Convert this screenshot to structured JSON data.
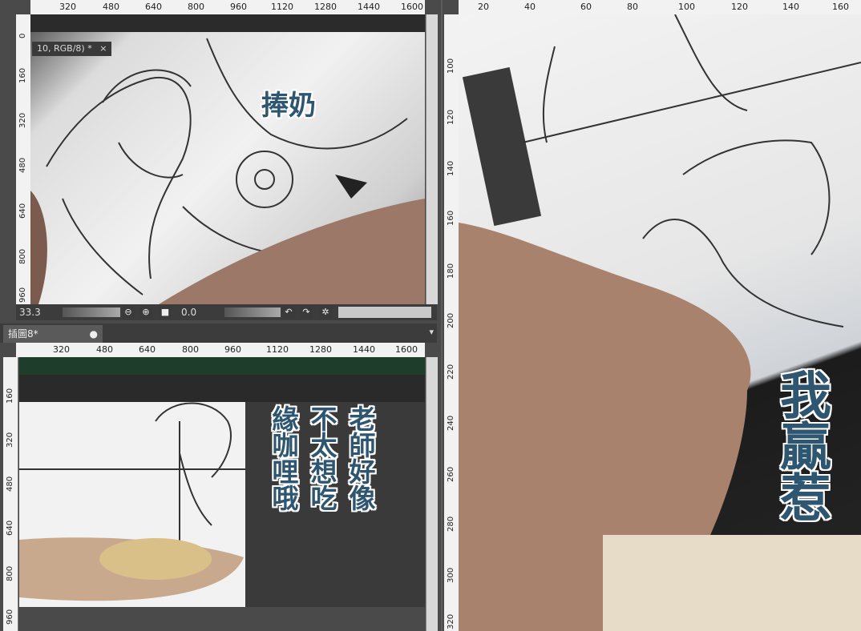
{
  "top_left_panel": {
    "doc_tab_label": "10, RGB/8) *",
    "caption": "捧奶",
    "ruler_h_ticks": [
      "320",
      "480",
      "640",
      "800",
      "960",
      "1120",
      "1280",
      "1440",
      "1600"
    ],
    "ruler_v_ticks": [
      "0",
      "160",
      "320",
      "480",
      "640",
      "800",
      "960"
    ],
    "status": {
      "zoom": "33.3",
      "angle": "0.0"
    }
  },
  "bottom_left_panel": {
    "tab_label": "插圖8*",
    "ruler_h_ticks": [
      "320",
      "480",
      "640",
      "800",
      "960",
      "1120",
      "1280",
      "1440",
      "1600"
    ],
    "ruler_v_ticks": [
      "160",
      "320",
      "480",
      "640",
      "800",
      "960"
    ],
    "caption_columns": [
      "緣咖哩哦",
      "不太想吃",
      "老師好像"
    ]
  },
  "right_panel": {
    "ruler_h_ticks": [
      "20",
      "40",
      "60",
      "80",
      "100",
      "120",
      "140",
      "160"
    ],
    "ruler_v_ticks": [
      "100",
      "120",
      "140",
      "160",
      "180",
      "200",
      "220",
      "240",
      "260",
      "280",
      "300",
      "320"
    ],
    "caption": "我贏惹"
  },
  "colors": {
    "caption": "#2f5670",
    "ui_dark": "#3c3c3c",
    "ruler": "#f2f2f2"
  }
}
